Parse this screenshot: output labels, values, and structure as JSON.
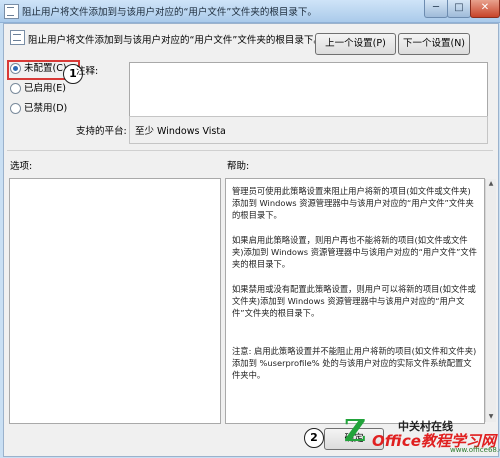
{
  "window": {
    "title": "阻止用户将文件添加到与该用户对应的“用户文件”文件夹的根目录下。",
    "minimize": "─",
    "maximize": "□",
    "close": "✕"
  },
  "header": {
    "policy_title": "阻止用户将文件添加到与该用户对应的“用户文件”文件夹的根目录下。",
    "prev_button": "上一个设置(P)",
    "next_button": "下一个设置(N)"
  },
  "state": {
    "options": [
      {
        "label": "未配置(C)",
        "selected": true
      },
      {
        "label": "已启用(E)",
        "selected": false
      },
      {
        "label": "已禁用(D)",
        "selected": false
      }
    ]
  },
  "comment": {
    "label": "注释:",
    "value": ""
  },
  "platform": {
    "label": "支持的平台:",
    "value": "至少 Windows Vista"
  },
  "options_panel": {
    "label": "选项:"
  },
  "help_panel": {
    "label": "帮助:",
    "paragraphs": [
      "管理员可使用此策略设置来阻止用户将新的项目(如文件或文件夹)添加到 Windows 资源管理器中与该用户对应的“用户文件”文件夹的根目录下。",
      "如果启用此策略设置，则用户再也不能将新的项目(如文件或文件夹)添加到 Windows 资源管理器中与该用户对应的“用户文件”文件夹的根目录下。",
      "如果禁用或没有配置此策略设置，则用户可以将新的项目(如文件或文件夹)添加到 Windows 资源管理器中与该用户对应的“用户文件”文件夹的根目录下。",
      "注意: 启用此策略设置并不能阻止用户将新的项目(如文件和文件夹)添加到 %userprofile% 处的与该用户对应的实际文件系统配置文件夹中。"
    ]
  },
  "footer": {
    "ok_button": "确定"
  },
  "callouts": {
    "one": "1",
    "two": "2"
  },
  "watermark": {
    "logo": "Z",
    "top": "中关村在线",
    "main": "Office教程学习网",
    "url": "www.office68.com"
  },
  "colors": {
    "highlight": "#d83a37",
    "titlebar": "#aacaea",
    "watermark_red": "#e02020",
    "watermark_green": "#22a33b"
  }
}
